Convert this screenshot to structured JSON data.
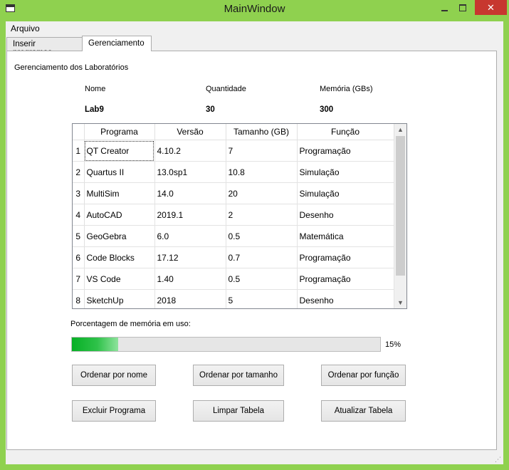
{
  "window": {
    "title": "MainWindow",
    "close_glyph": "✕",
    "icon": "app-window-icon"
  },
  "menu": {
    "items": [
      "Arquivo"
    ]
  },
  "tabs": [
    {
      "label": "Inserir programas",
      "active": false
    },
    {
      "label": "Gerenciamento",
      "active": true
    }
  ],
  "section": {
    "title": "Gerenciamento dos Laboratórios"
  },
  "lab_info": {
    "headers": {
      "name": "Nome",
      "quantity": "Quantidade",
      "memory": "Memória (GBs)"
    },
    "values": {
      "name": "Lab9",
      "quantity": "30",
      "memory": "300"
    }
  },
  "table": {
    "columns": [
      "Programa",
      "Versão",
      "Tamanho (GB)",
      "Função"
    ],
    "rows": [
      {
        "index": "1",
        "program": "QT Creator",
        "version": "4.10.2",
        "size": "7",
        "function": "Programação"
      },
      {
        "index": "2",
        "program": "Quartus II",
        "version": "13.0sp1",
        "size": "10.8",
        "function": "Simulação"
      },
      {
        "index": "3",
        "program": "MultiSim",
        "version": "14.0",
        "size": "20",
        "function": "Simulação"
      },
      {
        "index": "4",
        "program": "AutoCAD",
        "version": "2019.1",
        "size": "2",
        "function": "Desenho"
      },
      {
        "index": "5",
        "program": "GeoGebra",
        "version": "6.0",
        "size": "0.5",
        "function": "Matemática"
      },
      {
        "index": "6",
        "program": "Code Blocks",
        "version": "17.12",
        "size": "0.7",
        "function": "Programação"
      },
      {
        "index": "7",
        "program": "VS Code",
        "version": "1.40",
        "size": "0.5",
        "function": "Programação"
      },
      {
        "index": "8",
        "program": "SketchUp",
        "version": "2018",
        "size": "5",
        "function": "Desenho"
      }
    ],
    "scroll_up": "▲",
    "scroll_down": "▼"
  },
  "memory": {
    "label": "Porcentagem de memória em uso:",
    "percent_text": "15%",
    "percent_value": 15,
    "bar_color": "#06b025"
  },
  "buttons": {
    "sort_name": "Ordenar por nome",
    "sort_size": "Ordenar por tamanho",
    "sort_function": "Ordenar por função",
    "delete_program": "Excluir Programa",
    "clear_table": "Limpar Tabela",
    "update_table": "Atualizar Tabela"
  },
  "colors": {
    "window_frame": "#8fd14f",
    "close_button": "#c7372f"
  }
}
